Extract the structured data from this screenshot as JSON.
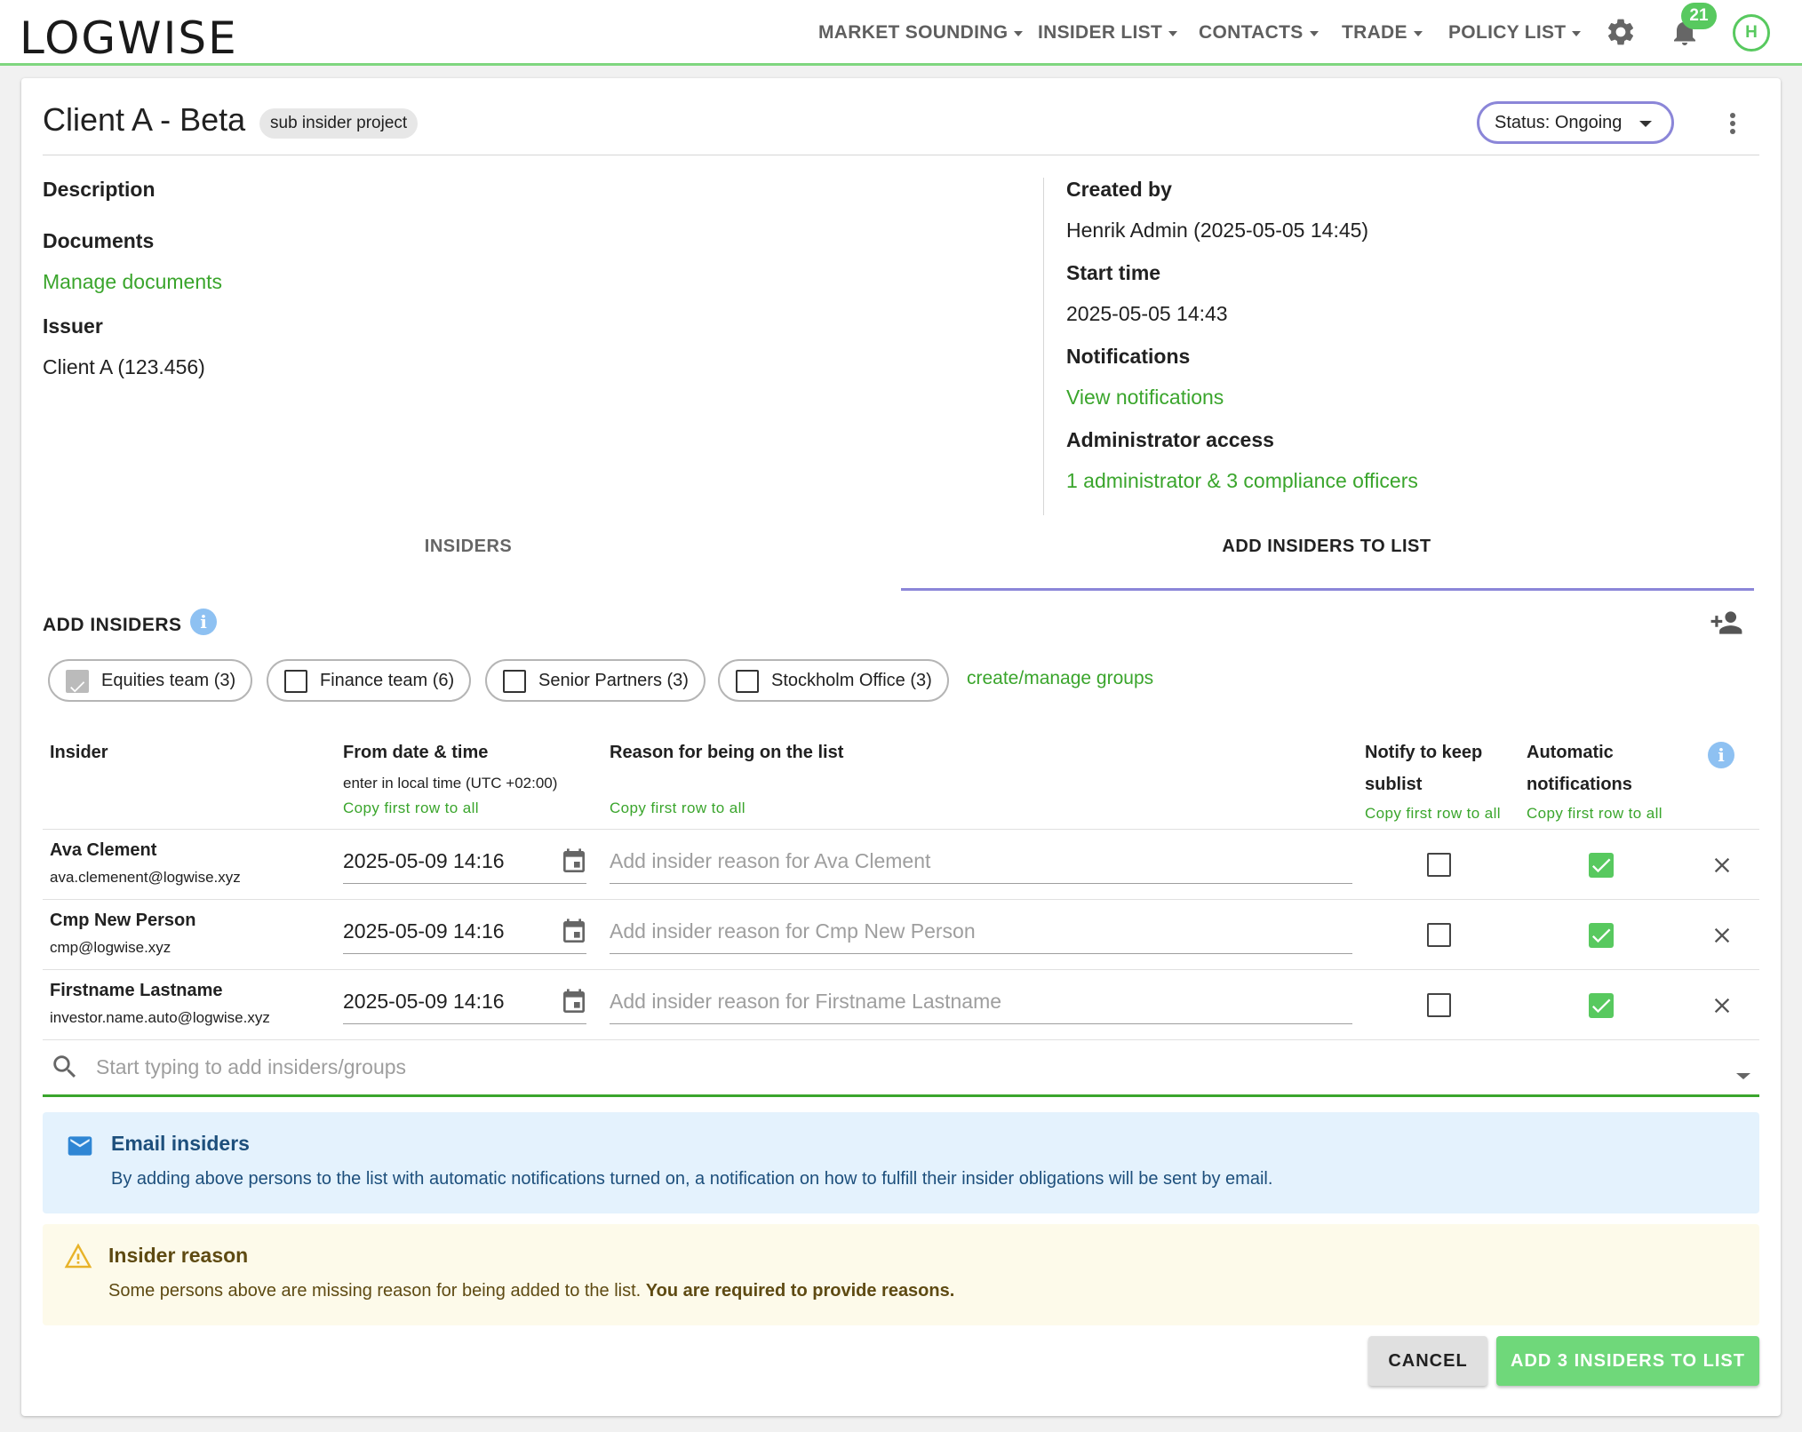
{
  "nav": {
    "logo": "LOGWISE",
    "items": [
      "MARKET SOUNDING",
      "INSIDER LIST",
      "CONTACTS",
      "TRADE",
      "POLICY LIST"
    ],
    "notifications_count": "21",
    "avatar_initial": "H"
  },
  "project": {
    "title": "Client A - Beta",
    "chip": "sub insider project",
    "status": "Status: Ongoing"
  },
  "left_info": {
    "description_label": "Description",
    "documents_label": "Documents",
    "documents_link": "Manage documents",
    "issuer_label": "Issuer",
    "issuer_value": "Client A (123.456)"
  },
  "right_info": {
    "created_by_label": "Created by",
    "created_by_value": "Henrik Admin (2025-05-05 14:45)",
    "start_time_label": "Start time",
    "start_time_value": "2025-05-05 14:43",
    "notifications_label": "Notifications",
    "notifications_link": "View notifications",
    "admin_access_label": "Administrator access",
    "admin_access_link": "1 administrator & 3 compliance officers"
  },
  "tabs": [
    "INSIDERS",
    "ADD INSIDERS TO LIST"
  ],
  "add_insiders": {
    "title": "ADD INSIDERS",
    "groups": [
      {
        "label": "Equities team (3)",
        "checked": true
      },
      {
        "label": "Finance team (6)",
        "checked": false
      },
      {
        "label": "Senior Partners (3)",
        "checked": false
      },
      {
        "label": "Stockholm Office (3)",
        "checked": false
      }
    ],
    "manage_groups_link": "create/manage groups"
  },
  "table": {
    "col_insider": "Insider",
    "col_from": "From date & time",
    "col_from_sub": "enter in local time (UTC +02:00)",
    "col_reason": "Reason for being on the list",
    "col_notify_1": "Notify to keep",
    "col_notify_2": "sublist",
    "col_auto_1": "Automatic",
    "col_auto_2": "notifications",
    "copy_label": "Copy first row to all",
    "rows": [
      {
        "name": "Ava Clement",
        "email": "ava.clemenent@logwise.xyz",
        "date": "2025-05-09 14:16",
        "reason_placeholder": "Add insider reason for Ava Clement",
        "notify": false,
        "auto": true
      },
      {
        "name": "Cmp New Person",
        "email": "cmp@logwise.xyz",
        "date": "2025-05-09 14:16",
        "reason_placeholder": "Add insider reason for Cmp New Person",
        "notify": false,
        "auto": true
      },
      {
        "name": "Firstname Lastname",
        "email": "investor.name.auto@logwise.xyz",
        "date": "2025-05-09 14:16",
        "reason_placeholder": "Add insider reason for Firstname Lastname",
        "notify": false,
        "auto": true
      }
    ]
  },
  "search": {
    "placeholder": "Start typing to add insiders/groups"
  },
  "email_alert": {
    "title": "Email insiders",
    "text": "By adding above persons to the list with automatic notifications turned on, a notification on how to fulfill their insider obligations will be sent by email."
  },
  "reason_alert": {
    "title": "Insider reason",
    "text": "Some persons above are missing reason for being added to the list. ",
    "text_bold": "You are required to provide reasons."
  },
  "buttons": {
    "cancel": "CANCEL",
    "add": "ADD 3 INSIDERS TO LIST"
  },
  "colors": {
    "accent_green": "#58c95f",
    "link_green": "#3aa52c",
    "tab_accent": "#8b86d8",
    "info_blue": "#e4f2fd",
    "warn_yellow": "#fdfaea"
  }
}
